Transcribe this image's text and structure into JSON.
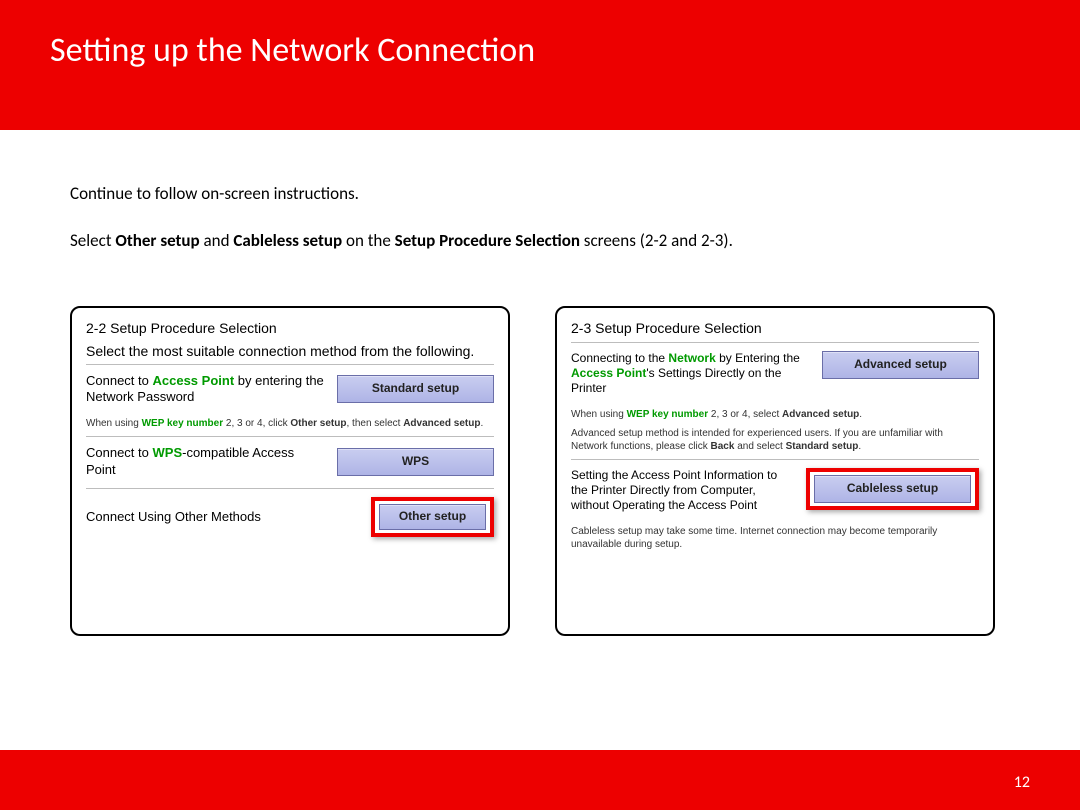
{
  "header": {
    "title": "Setting up the Network Connection"
  },
  "intro": {
    "line1": "Continue to follow on-screen instructions.",
    "line2_pre": "Select ",
    "line2_b1": "Other setup",
    "line2_mid": " and ",
    "line2_b2": "Cableless setup",
    "line2_mid2": " on the ",
    "line2_b3": "Setup Procedure Selection",
    "line2_post": " screens (2-2 and 2-3)."
  },
  "panel_left": {
    "title": "2-2 Setup Procedure Selection",
    "subtitle": "Select the most suitable connection method from the following.",
    "row1": {
      "desc_pre": "Connect to ",
      "desc_ap": "Access Point",
      "desc_post": " by entering the Network Password",
      "button": "Standard setup"
    },
    "note1_pre": "When using ",
    "note1_green": "WEP key number",
    "note1_mid": " 2, 3 or 4, click ",
    "note1_b1": "Other setup",
    "note1_mid2": ", then select ",
    "note1_b2": "Advanced setup",
    "note1_post": ".",
    "row2": {
      "desc_pre": "Connect to ",
      "desc_ap": "WPS",
      "desc_post": "-compatible Access Point",
      "button": "WPS"
    },
    "row3": {
      "desc": "Connect Using Other Methods",
      "button": "Other setup"
    }
  },
  "panel_right": {
    "title": "2-3 Setup Procedure Selection",
    "row1": {
      "desc_pre": "Connecting to the ",
      "desc_g1": "Network",
      "desc_mid": " by Entering the ",
      "desc_g2": "Access Point",
      "desc_post": "'s Settings Directly on the Printer",
      "button": "Advanced setup"
    },
    "note1_pre": "When using ",
    "note1_green": "WEP key number",
    "note1_mid": " 2, 3 or 4, select ",
    "note1_b1": "Advanced setup",
    "note1_post": ".",
    "note2_pre": "Advanced setup method is intended for experienced users. If you are unfamiliar with Network functions, please click ",
    "note2_b1": "Back",
    "note2_mid": " and select ",
    "note2_b2": "Standard setup",
    "note2_post": ".",
    "row2": {
      "desc": "Setting the Access Point Information to the Printer Directly from Computer, without Operating the Access Point",
      "button": "Cableless setup"
    },
    "note3": "Cableless setup may take some time. Internet connection may become temporarily unavailable during setup."
  },
  "page_number": "12"
}
